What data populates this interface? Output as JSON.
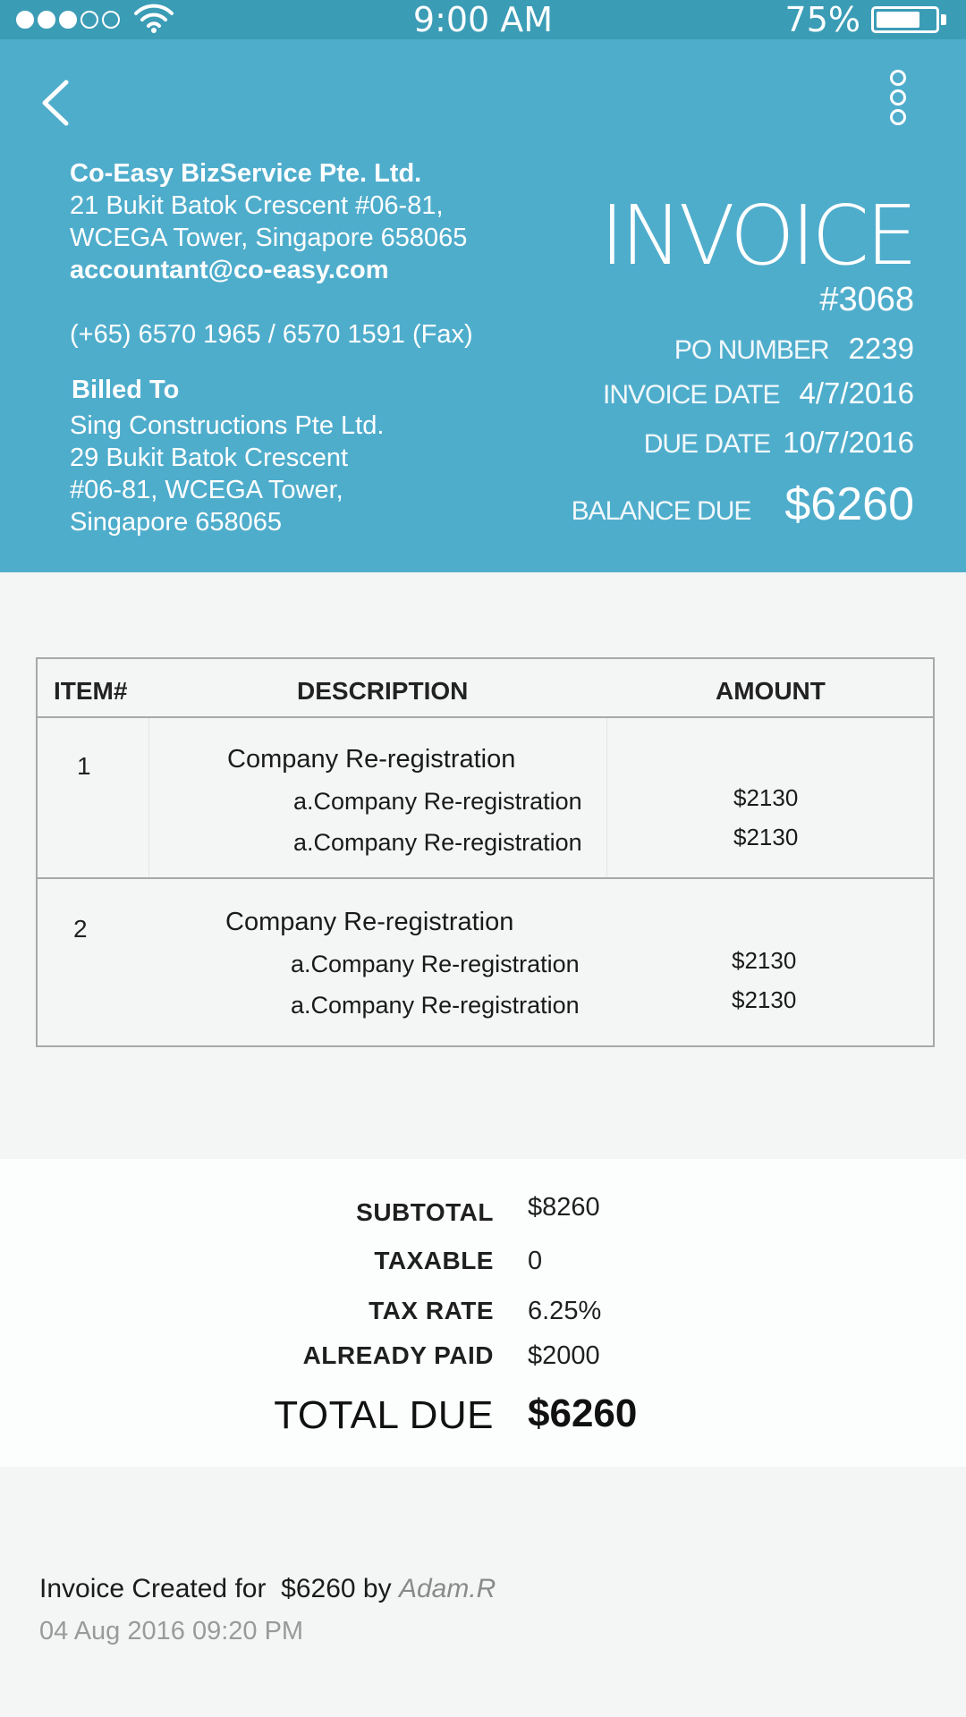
{
  "status_bar": {
    "time": "9:00 AM",
    "battery_percent": "75%",
    "battery_level": 0.75,
    "signal_bars": 3,
    "signal_max": 5
  },
  "header": {
    "company": {
      "name": "Co-Easy BizService Pte. Ltd.",
      "address_line1": "21 Bukit Batok Crescent #06-81,",
      "address_line2": "WCEGA Tower, Singapore 658065",
      "email": "accountant@co-easy.com",
      "phone": "(+65) 6570 1965 / 6570 1591 (Fax)"
    },
    "billed_to": {
      "label": "Billed To",
      "line1": "Sing Constructions Pte Ltd.",
      "line2": "29 Bukit Batok Crescent",
      "line3": "#06-81, WCEGA Tower,",
      "line4": "Singapore 658065"
    },
    "invoice_title": "INVOICE",
    "invoice_number": "#3068",
    "po_label": "PO NUMBER",
    "po_value": "2239",
    "invoice_date_label": "INVOICE DATE",
    "invoice_date_value": "4/7/2016",
    "due_date_label": "DUE DATE",
    "due_date_value": "10/7/2016",
    "balance_due_label": "BALANCE DUE",
    "balance_due_value": "$6260"
  },
  "items_table": {
    "headers": {
      "item": "ITEM#",
      "description": "DESCRIPTION",
      "amount": "AMOUNT"
    },
    "rows": [
      {
        "number": "1",
        "title": "Company Re-registration",
        "sub1": "a.Company Re-registration",
        "sub2": "a.Company Re-registration",
        "amount1": "$2130",
        "amount2": "$2130"
      },
      {
        "number": "2",
        "title": "Company Re-registration",
        "sub1": "a.Company Re-registration",
        "sub2": "a.Company Re-registration",
        "amount1": "$2130",
        "amount2": "$2130"
      }
    ]
  },
  "totals": {
    "subtotal_label": "SUBTOTAL",
    "subtotal_value": "$8260",
    "taxable_label": "TAXABLE",
    "taxable_value": "0",
    "tax_rate_label": "TAX RATE",
    "tax_rate_value": "6.25%",
    "already_paid_label": "ALREADY PAID",
    "already_paid_value": "$2000",
    "total_due_label": "TOTAL DUE",
    "total_due_value": "$6260"
  },
  "activity": {
    "prefix": "Invoice Created for",
    "amount": "$6260",
    "by": "by",
    "author": "Adam.R",
    "timestamp": "04 Aug 2016 09:20 PM"
  },
  "colors": {
    "header_bg": "#4fadcc",
    "status_bar_bg": "#3b9cb6",
    "page_bg": "#f4f5f5",
    "totals_bg": "#fcfefe",
    "author_text": "#8a8a8a"
  }
}
